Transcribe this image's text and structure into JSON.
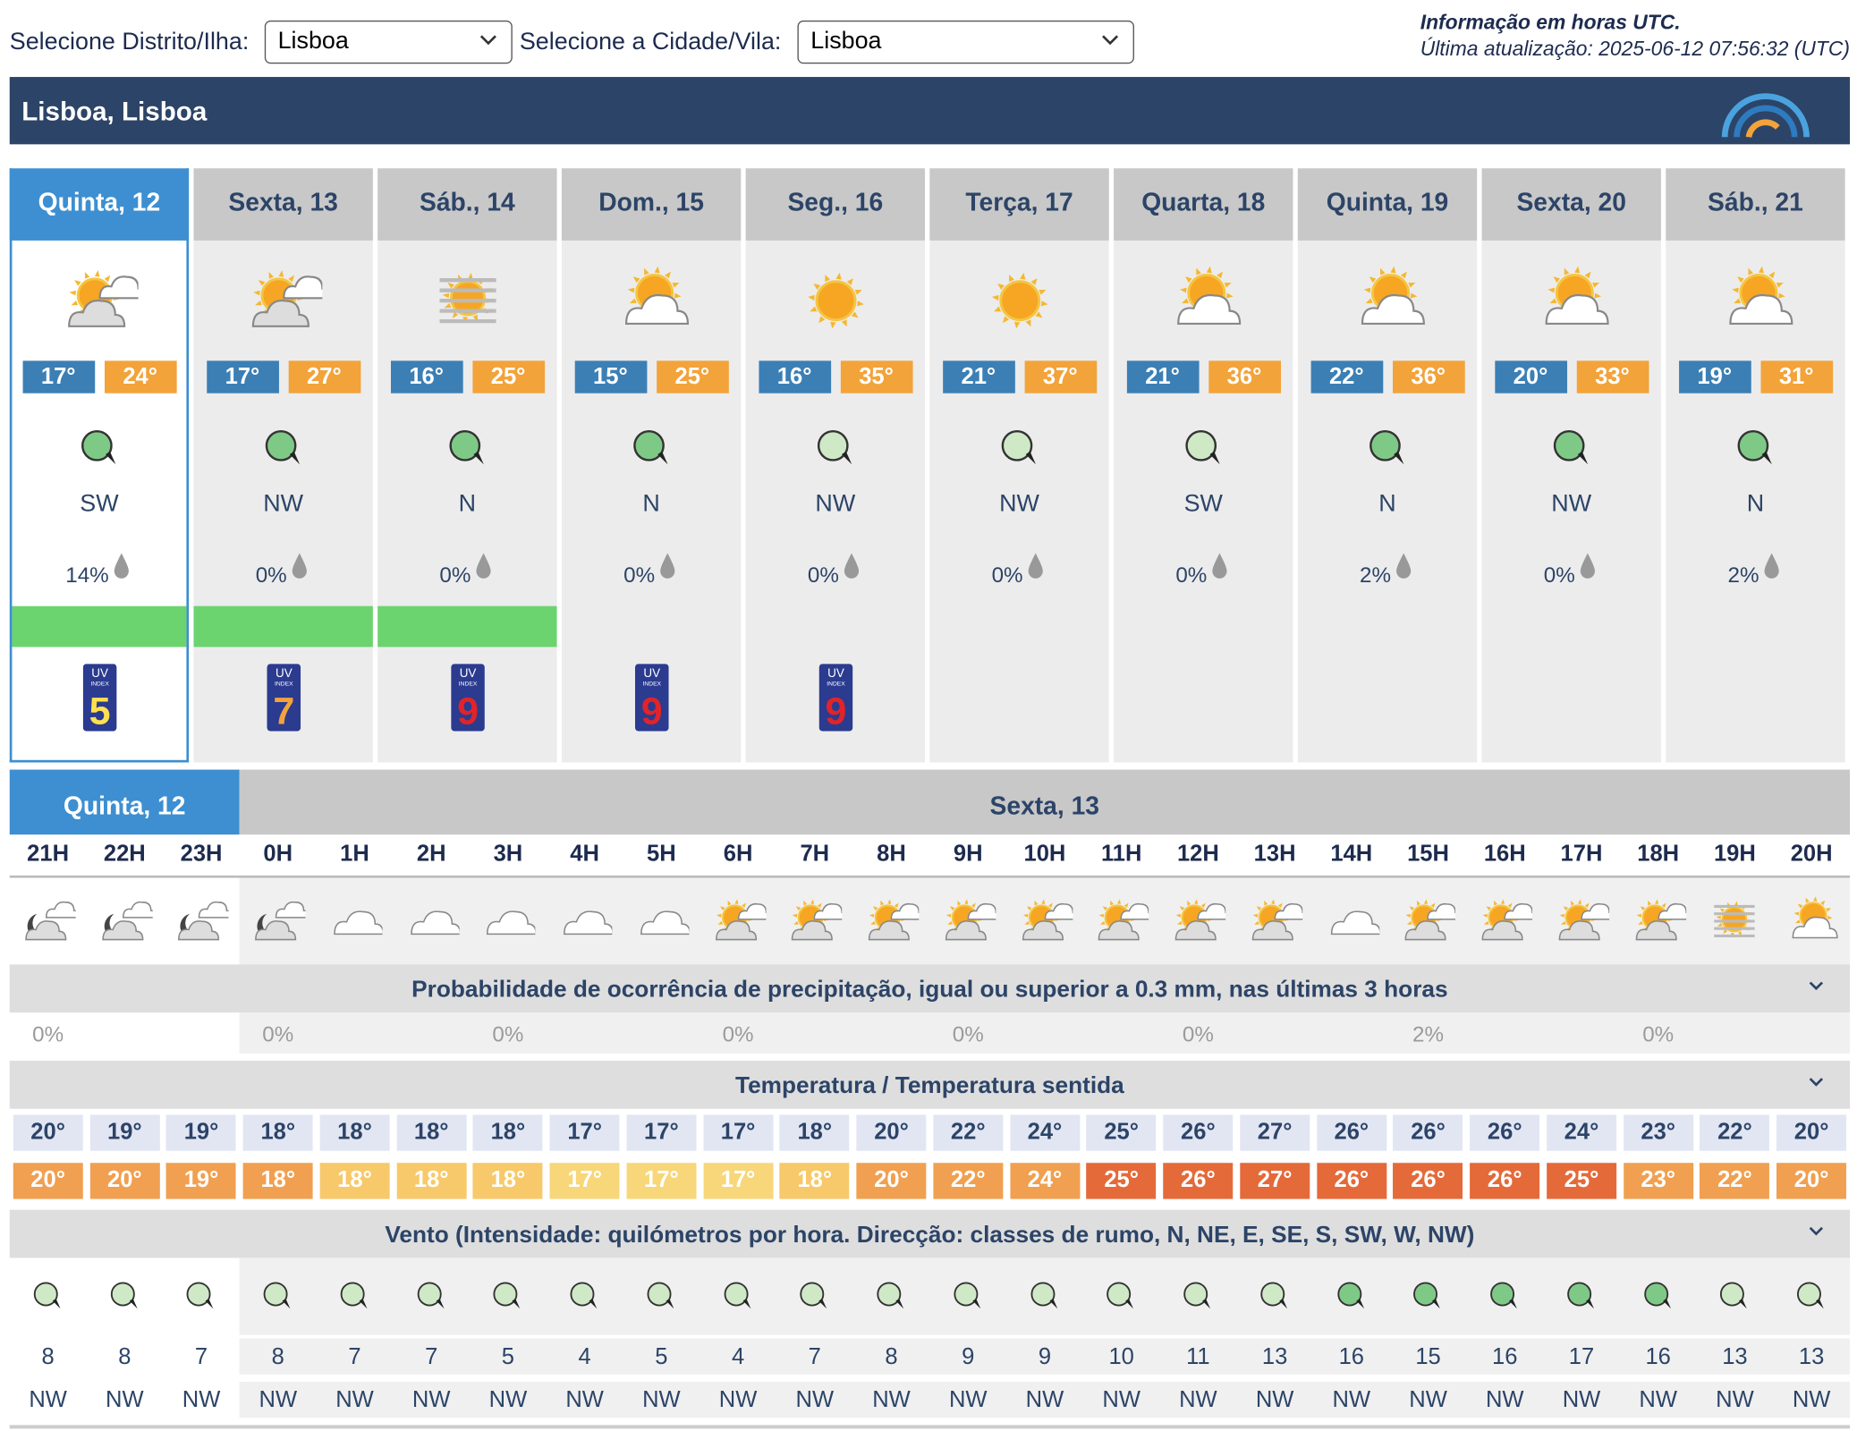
{
  "header": {
    "district_label": "Selecione Distrito/Ilha:",
    "district_value": "Lisboa",
    "city_label": "Selecione a Cidade/Vila:",
    "city_value": "Lisboa",
    "info_line1": "Informação em horas UTC.",
    "info_line2": "Última atualização: 2025-06-12 07:56:32 (UTC)"
  },
  "location_title": "Lisboa, Lisboa",
  "colors": {
    "title_bg": "#2c4467",
    "active_blue": "#3d8fd1",
    "min_temp": "#3b7fb5",
    "max_temp": "#f2a33a",
    "green": "#6bd46e"
  },
  "days": [
    {
      "label": "Quinta, 12",
      "icon": "sun-cloud-cloud-icon",
      "min": "17°",
      "max": "24°",
      "wind": "SW",
      "prec": "14%",
      "green": true,
      "uv": "5"
    },
    {
      "label": "Sexta, 13",
      "icon": "sun-cloud-cloud-icon",
      "min": "17°",
      "max": "27°",
      "wind": "NW",
      "prec": "0%",
      "green": true,
      "uv": "7"
    },
    {
      "label": "Sáb., 14",
      "icon": "fog-sun-icon",
      "min": "16°",
      "max": "25°",
      "wind": "N",
      "prec": "0%",
      "green": true,
      "uv": "9"
    },
    {
      "label": "Dom., 15",
      "icon": "sun-cloud-icon",
      "min": "15°",
      "max": "25°",
      "wind": "N",
      "prec": "0%",
      "green": false,
      "uv": "9"
    },
    {
      "label": "Seg., 16",
      "icon": "sun-icon",
      "min": "16°",
      "max": "35°",
      "wind": "NW",
      "prec": "0%",
      "green": false,
      "uv": "9"
    },
    {
      "label": "Terça, 17",
      "icon": "sun-icon",
      "min": "21°",
      "max": "37°",
      "wind": "NW",
      "prec": "0%",
      "green": false,
      "uv": ""
    },
    {
      "label": "Quarta, 18",
      "icon": "sun-cloud-icon",
      "min": "21°",
      "max": "36°",
      "wind": "SW",
      "prec": "0%",
      "green": false,
      "uv": ""
    },
    {
      "label": "Quinta, 19",
      "icon": "sun-cloud-icon",
      "min": "22°",
      "max": "36°",
      "wind": "N",
      "prec": "2%",
      "green": false,
      "uv": ""
    },
    {
      "label": "Sexta, 20",
      "icon": "sun-cloud-icon",
      "min": "20°",
      "max": "33°",
      "wind": "NW",
      "prec": "0%",
      "green": false,
      "uv": ""
    },
    {
      "label": "Sáb., 21",
      "icon": "sun-cloud-icon",
      "min": "19°",
      "max": "31°",
      "wind": "N",
      "prec": "2%",
      "green": false,
      "uv": ""
    }
  ],
  "hourly": {
    "day_left": "Quinta, 12",
    "day_right": "Sexta, 13",
    "hours": [
      "21H",
      "22H",
      "23H",
      "0H",
      "1H",
      "2H",
      "3H",
      "4H",
      "5H",
      "6H",
      "7H",
      "8H",
      "9H",
      "10H",
      "11H",
      "12H",
      "13H",
      "14H",
      "15H",
      "16H",
      "17H",
      "18H",
      "19H",
      "20H"
    ],
    "icons": [
      "moon-cloud-icon",
      "moon-cloud-icon",
      "moon-cloud-icon",
      "moon-cloud-icon",
      "cloud-icon",
      "cloud-icon",
      "cloud-icon",
      "cloud-icon",
      "cloud-icon",
      "sun-cloud-cloud-icon",
      "sun-cloud-cloud-icon",
      "sun-cloud-cloud-icon",
      "sun-cloud-cloud-icon",
      "sun-cloud-cloud-icon",
      "sun-cloud-cloud-icon",
      "sun-cloud-cloud-icon",
      "sun-cloud-cloud-icon",
      "cloud-icon",
      "sun-cloud-cloud-icon",
      "sun-cloud-cloud-icon",
      "sun-cloud-cloud-icon",
      "sun-cloud-cloud-icon",
      "fog-sun-icon",
      "sun-cloud-icon"
    ],
    "precip_title": "Probabilidade de ocorrência de precipitação, igual ou superior a 0.3 mm, nas últimas 3 horas",
    "precip": [
      "0%",
      "",
      "",
      "0%",
      "",
      "",
      "0%",
      "",
      "",
      "0%",
      "",
      "",
      "0%",
      "",
      "",
      "0%",
      "",
      "",
      "2%",
      "",
      "",
      "0%",
      "",
      ""
    ],
    "temp_title": "Temperatura / Temperatura sentida",
    "temps": [
      "20°",
      "19°",
      "19°",
      "18°",
      "18°",
      "18°",
      "18°",
      "17°",
      "17°",
      "17°",
      "18°",
      "20°",
      "22°",
      "24°",
      "25°",
      "26°",
      "27°",
      "26°",
      "26°",
      "26°",
      "24°",
      "23°",
      "22°",
      "20°"
    ],
    "feels": [
      "20°",
      "20°",
      "19°",
      "18°",
      "18°",
      "18°",
      "18°",
      "17°",
      "17°",
      "17°",
      "18°",
      "20°",
      "22°",
      "24°",
      "25°",
      "26°",
      "27°",
      "26°",
      "26°",
      "26°",
      "25°",
      "23°",
      "22°",
      "20°"
    ],
    "feels_colors": [
      "#f0a050",
      "#f0a050",
      "#f0a050",
      "#f0a050",
      "#f7c96a",
      "#f7c96a",
      "#f7c96a",
      "#f7d77a",
      "#f7d77a",
      "#f7d77a",
      "#f7c96a",
      "#f0a050",
      "#f0a050",
      "#f0a050",
      "#e46a3a",
      "#e46a3a",
      "#e46a3a",
      "#e46a3a",
      "#e46a3a",
      "#e46a3a",
      "#e46a3a",
      "#f0a050",
      "#f0a050",
      "#f0a050"
    ],
    "wind_title": "Vento (Intensidade: quilómetros por hora. Direcção: classes de rumo, N, NE, E, SE, S, SW, W, NW)",
    "wind_speed": [
      "8",
      "8",
      "7",
      "8",
      "7",
      "7",
      "5",
      "4",
      "5",
      "4",
      "7",
      "8",
      "9",
      "9",
      "10",
      "11",
      "13",
      "16",
      "15",
      "16",
      "17",
      "16",
      "13",
      "13"
    ],
    "wind_dir": [
      "NW",
      "NW",
      "NW",
      "NW",
      "NW",
      "NW",
      "NW",
      "NW",
      "NW",
      "NW",
      "NW",
      "NW",
      "NW",
      "NW",
      "NW",
      "NW",
      "NW",
      "NW",
      "NW",
      "NW",
      "NW",
      "NW",
      "NW",
      "NW"
    ],
    "wind_strength": [
      0,
      0,
      0,
      0,
      0,
      0,
      0,
      0,
      0,
      0,
      0,
      0,
      0,
      0,
      0,
      0,
      0,
      1,
      1,
      1,
      1,
      1,
      0,
      0
    ]
  }
}
